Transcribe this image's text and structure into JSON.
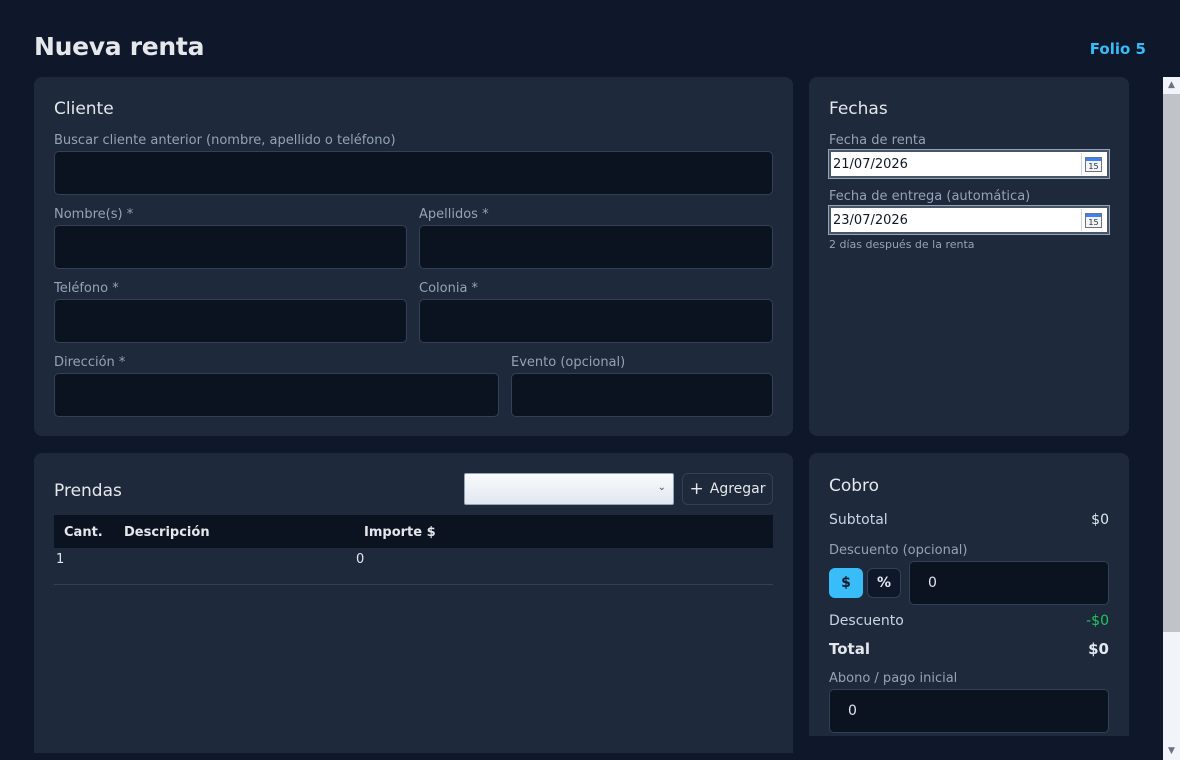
{
  "header": {
    "title": "Nueva renta",
    "folio": "Folio 5"
  },
  "cliente": {
    "title": "Cliente",
    "buscar_label": "Buscar cliente anterior (nombre, apellido o teléfono)",
    "nombre_label": "Nombre(s) *",
    "apellidos_label": "Apellidos *",
    "telefono_label": "Teléfono *",
    "colonia_label": "Colonia *",
    "direccion_label": "Dirección *",
    "evento_label": "Evento (opcional)",
    "buscar_value": "",
    "nombre_value": "",
    "apellidos_value": "",
    "telefono_value": "",
    "colonia_value": "",
    "direccion_value": "",
    "evento_value": ""
  },
  "fechas": {
    "title": "Fechas",
    "renta_label": "Fecha de renta",
    "renta_value": "21/07/2026",
    "entrega_label": "Fecha de entrega (automática)",
    "entrega_value": "23/07/2026",
    "hint": "2 días después de la renta",
    "calendar_day": "15",
    "icon": "calendar-icon"
  },
  "prendas": {
    "title": "Prendas",
    "select_value": "",
    "add_icon": "+",
    "add_label": "Agregar",
    "columns": [
      "Cant.",
      "Descripción",
      "Importe $"
    ],
    "rows": [
      {
        "cant": "1",
        "descripcion": "",
        "importe": "0"
      }
    ]
  },
  "cobro": {
    "title": "Cobro",
    "subtotal_label": "Subtotal",
    "subtotal_value": "$0",
    "descuento_opt_label": "Descuento (opcional)",
    "toggle_dollar": "$",
    "toggle_percent": "%",
    "descuento_input": "0",
    "descuento_label": "Descuento",
    "descuento_value": "-$0",
    "total_label": "Total",
    "total_value": "$0",
    "abono_label": "Abono / pago inicial",
    "abono_input": "0"
  },
  "colors": {
    "background": "#0f172a",
    "card": "#1e293b",
    "accent": "#38bdf8",
    "discount": "#22c55e",
    "input": "#0b1220"
  }
}
